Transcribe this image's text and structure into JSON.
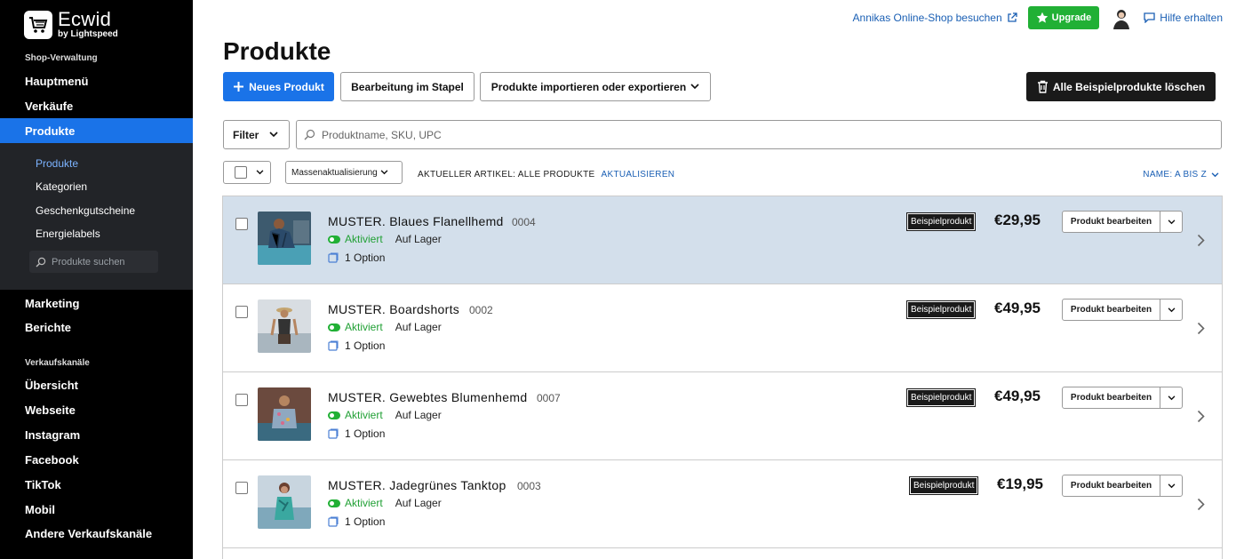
{
  "sidebar": {
    "logo_main": "Ecwid",
    "logo_sub": "by Lightspeed",
    "section_shop": "Shop-Verwaltung",
    "items_top": [
      "Hauptmenü",
      "Verkäufe"
    ],
    "active_item": "Produkte",
    "sub_items": [
      "Produkte",
      "Kategorien",
      "Geschenkgutscheine",
      "Energielabels"
    ],
    "sub_search_placeholder": "Produkte suchen",
    "items_mid": [
      "Marketing",
      "Berichte"
    ],
    "section_channels": "Verkaufskanäle",
    "channels": [
      "Übersicht",
      "Webseite",
      "Instagram",
      "Facebook",
      "TikTok",
      "Mobil",
      "Andere Verkaufskanäle"
    ]
  },
  "topbar": {
    "visit_shop": "Annikas Online-Shop besuchen",
    "upgrade": "Upgrade",
    "help": "Hilfe erhalten"
  },
  "page": {
    "title": "Produkte",
    "new_product": "Neues Produkt",
    "bulk_edit": "Bearbeitung im Stapel",
    "import_export": "Produkte importieren oder exportieren",
    "delete_samples": "Alle Beispielprodukte löschen",
    "filter": "Filter",
    "search_placeholder": "Produktname, SKU, UPC",
    "mass_update": "Massenaktualisierung",
    "current_label": "AKTUELLER ARTIKEL: ALLE PRODUKTE",
    "refresh": "AKTUALISIEREN",
    "sort": "NAME: A BIS Z"
  },
  "products": [
    {
      "name": "MUSTER. Blaues Flanellhemd",
      "sku": "0004",
      "status": "Aktiviert",
      "stock": "Auf Lager",
      "options": "1 Option",
      "badge": "Beispielprodukt",
      "price": "€29,95",
      "edit": "Produkt bearbeiten",
      "highlighted": true
    },
    {
      "name": "MUSTER. Boardshorts",
      "sku": "0002",
      "status": "Aktiviert",
      "stock": "Auf Lager",
      "options": "1 Option",
      "badge": "Beispielprodukt",
      "price": "€49,95",
      "edit": "Produkt bearbeiten",
      "highlighted": false
    },
    {
      "name": "MUSTER. Gewebtes Blumenhemd",
      "sku": "0007",
      "status": "Aktiviert",
      "stock": "Auf Lager",
      "options": "1 Option",
      "badge": "Beispielprodukt",
      "price": "€49,95",
      "edit": "Produkt bearbeiten",
      "highlighted": false
    },
    {
      "name": "MUSTER. Jadegrünes Tanktop",
      "sku": "0003",
      "status": "Aktiviert",
      "stock": "Auf Lager",
      "options": "1 Option",
      "badge": "Beispielprodukt",
      "price": "€19,95",
      "edit": "Produkt bearbeiten",
      "highlighted": false
    }
  ],
  "colors": {
    "accent": "#1a73e8",
    "upgrade": "#21b035",
    "active_status": "#21a035",
    "highlight_row": "#d3dfeb"
  },
  "icons": {
    "cart": "cart-icon",
    "external": "external-link-icon",
    "star": "star-icon",
    "chat": "chat-icon",
    "plus": "plus-icon",
    "trash": "trash-icon",
    "search": "search-icon",
    "chevron": "chevron-down-icon",
    "arrow": "chevron-right-icon",
    "toggle": "toggle-icon",
    "option": "option-icon"
  }
}
